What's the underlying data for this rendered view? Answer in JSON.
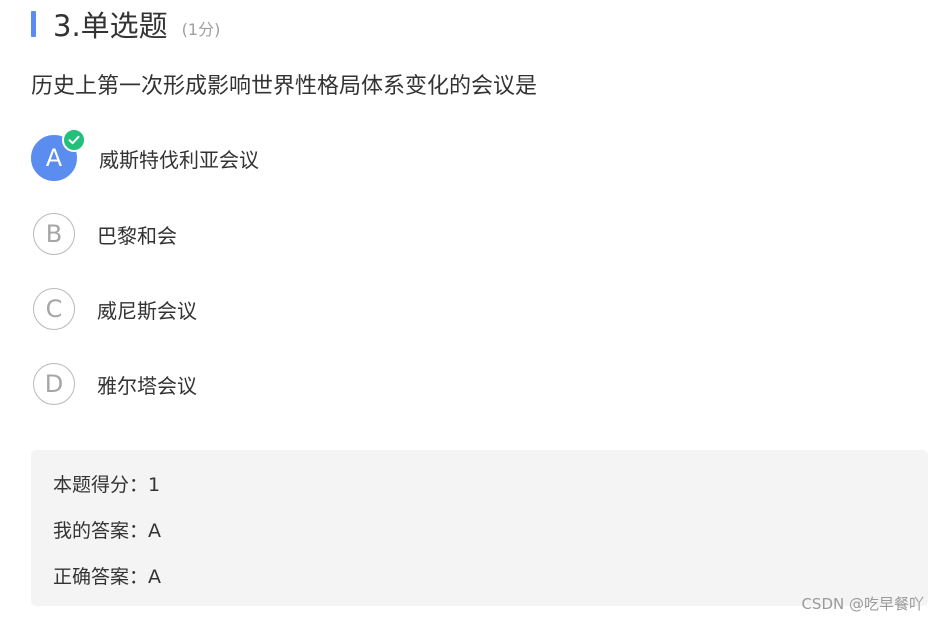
{
  "question": {
    "title": "3.单选题",
    "score": "(1分)",
    "stem": "历史上第一次形成影响世界性格局体系变化的会议是"
  },
  "options": [
    {
      "letter": "A",
      "text": "威斯特伐利亚会议",
      "selected": true
    },
    {
      "letter": "B",
      "text": "巴黎和会",
      "selected": false
    },
    {
      "letter": "C",
      "text": "威尼斯会议",
      "selected": false
    },
    {
      "letter": "D",
      "text": "雅尔塔会议",
      "selected": false
    }
  ],
  "result": {
    "score_line": "本题得分：1",
    "my_answer_line": "我的答案：A",
    "correct_answer_line": "正确答案：A"
  },
  "watermark": "CSDN @吃早餐吖",
  "colors": {
    "accent": "#5b8cf0",
    "check": "#22c07a",
    "panel": "#f4f4f4"
  },
  "icons": {
    "check": "check-icon"
  }
}
